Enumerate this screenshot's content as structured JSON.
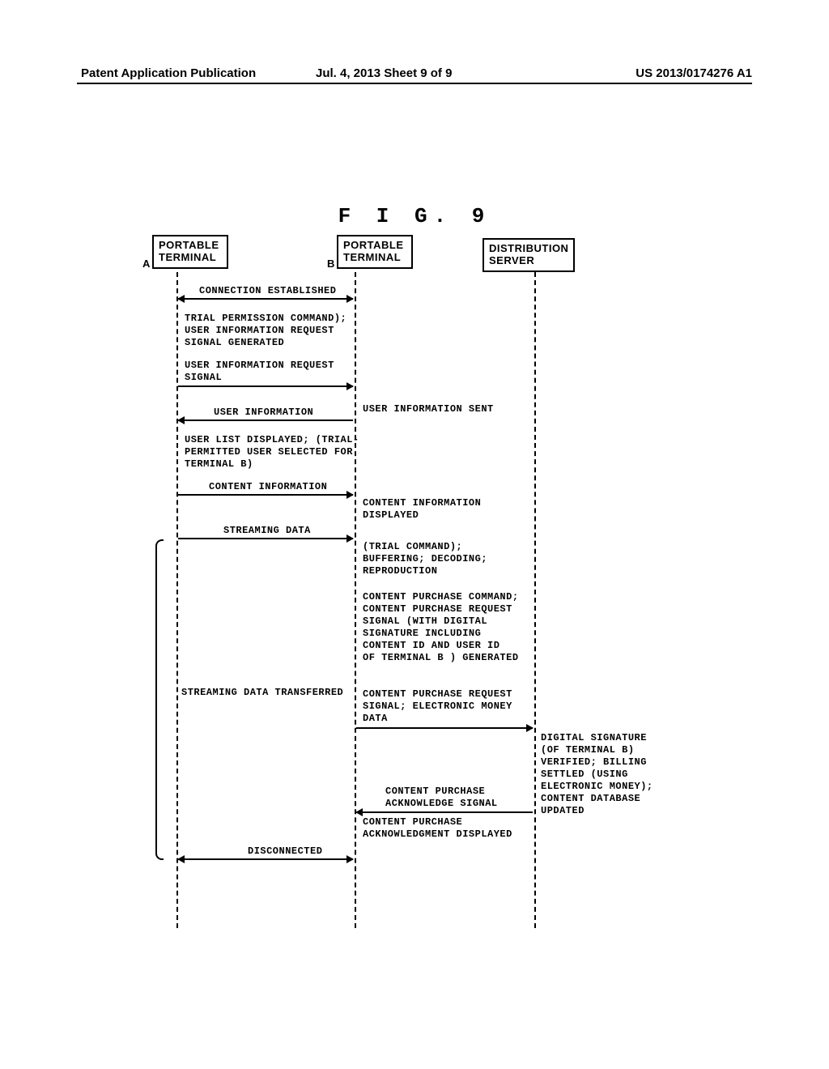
{
  "header": {
    "left": "Patent Application Publication",
    "mid": "Jul. 4, 2013   Sheet 9 of 9",
    "right": "US 2013/0174276 A1"
  },
  "figure_title": "F I G.  9",
  "actors": {
    "a": "PORTABLE\nTERMINAL",
    "a_sub": "A",
    "b": "PORTABLE\nTERMINAL",
    "b_sub": "B",
    "s": "DISTRIBUTION\nSERVER"
  },
  "messages": {
    "m1": "CONNECTION ESTABLISHED",
    "m2": "TRIAL PERMISSION COMMAND);\nUSER INFORMATION REQUEST\nSIGNAL GENERATED",
    "m3": "USER INFORMATION REQUEST\nSIGNAL",
    "m4": "USER INFORMATION",
    "m4r": "USER INFORMATION SENT",
    "m5": "USER LIST DISPLAYED; (TRIAL-\nPERMITTED USER SELECTED FOR\nTERMINAL B)",
    "m6": "CONTENT INFORMATION",
    "m6r": "CONTENT INFORMATION\nDISPLAYED",
    "m7": "STREAMING DATA",
    "m7r": "(TRIAL COMMAND);\nBUFFERING; DECODING;\nREPRODUCTION",
    "m8": "CONTENT PURCHASE COMMAND;\nCONTENT PURCHASE REQUEST\nSIGNAL (WITH DIGITAL\nSIGNATURE INCLUDING\nCONTENT ID AND USER ID\nOF TERMINAL B ) GENERATED",
    "m9": "STREAMING DATA TRANSFERRED",
    "m10": "CONTENT PURCHASE REQUEST\nSIGNAL; ELECTRONIC MONEY\nDATA",
    "m11": "DIGITAL SIGNATURE\n(OF TERMINAL B)\nVERIFIED; BILLING\nSETTLED (USING\nELECTRONIC MONEY);\nCONTENT DATABASE\nUPDATED",
    "m12": "CONTENT PURCHASE\nACKNOWLEDGE SIGNAL",
    "m13": "CONTENT PURCHASE\nACKNOWLEDGMENT DISPLAYED",
    "m14": "DISCONNECTED"
  }
}
